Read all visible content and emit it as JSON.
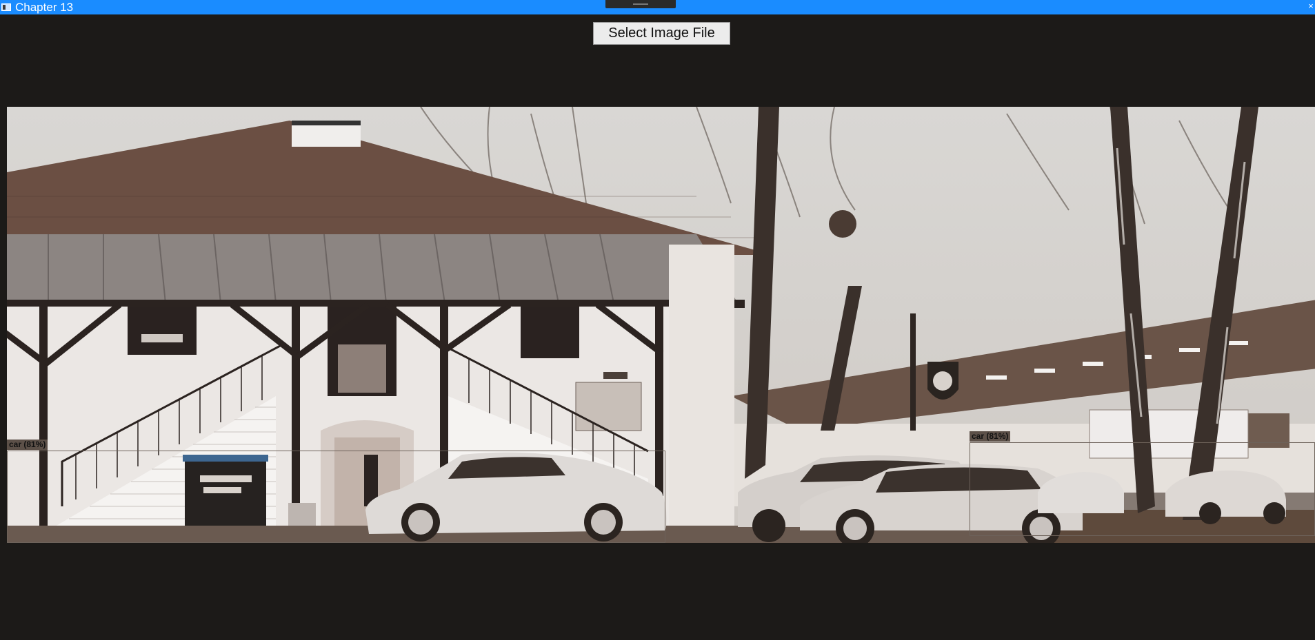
{
  "window": {
    "title": "Chapter 13",
    "close_glyph": "×",
    "titlebar_color": "#1a8cff"
  },
  "toolbar": {
    "select_label": "Select Image File"
  },
  "image": {
    "tone": "sepia",
    "content": "photo of a white house with tiled roof, outdoor staircase, parked cars and birch trees"
  },
  "detections": [
    {
      "label": "car (81%)",
      "class": "car",
      "confidence": 0.81
    },
    {
      "label": "car (81%)",
      "class": "car",
      "confidence": 0.81
    }
  ]
}
